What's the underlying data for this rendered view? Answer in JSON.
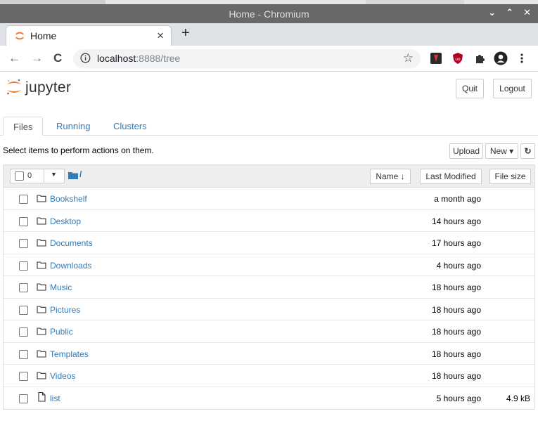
{
  "window": {
    "title": "Home - Chromium",
    "controls": [
      "⌄",
      "⌃",
      "✕"
    ]
  },
  "browser": {
    "tab_title": "Home",
    "tab_close": "×",
    "new_tab": "+",
    "back": "←",
    "forward": "→",
    "reload": "C",
    "url_host": "localhost",
    "url_rest": ":8888/tree",
    "star": "☆"
  },
  "jupyter": {
    "brand": "jupyter",
    "quit_label": "Quit",
    "logout_label": "Logout",
    "accent": "#f37726"
  },
  "tabs": [
    {
      "label": "Files",
      "active": true
    },
    {
      "label": "Running",
      "active": false
    },
    {
      "label": "Clusters",
      "active": false
    }
  ],
  "toolbar": {
    "hint": "Select items to perform actions on them.",
    "upload_label": "Upload",
    "new_label": "New ▾",
    "refresh": "↻"
  },
  "list_header": {
    "selected_count": "0",
    "path": "/",
    "name_sort": "Name ↓",
    "last_modified": "Last Modified",
    "file_size": "File size"
  },
  "items": [
    {
      "type": "folder",
      "name": "Bookshelf",
      "modified": "a month ago",
      "size": ""
    },
    {
      "type": "folder",
      "name": "Desktop",
      "modified": "14 hours ago",
      "size": ""
    },
    {
      "type": "folder",
      "name": "Documents",
      "modified": "17 hours ago",
      "size": ""
    },
    {
      "type": "folder",
      "name": "Downloads",
      "modified": "4 hours ago",
      "size": ""
    },
    {
      "type": "folder",
      "name": "Music",
      "modified": "18 hours ago",
      "size": ""
    },
    {
      "type": "folder",
      "name": "Pictures",
      "modified": "18 hours ago",
      "size": ""
    },
    {
      "type": "folder",
      "name": "Public",
      "modified": "18 hours ago",
      "size": ""
    },
    {
      "type": "folder",
      "name": "Templates",
      "modified": "18 hours ago",
      "size": ""
    },
    {
      "type": "folder",
      "name": "Videos",
      "modified": "18 hours ago",
      "size": ""
    },
    {
      "type": "file",
      "name": "list",
      "modified": "5 hours ago",
      "size": "4.9 kB"
    }
  ]
}
